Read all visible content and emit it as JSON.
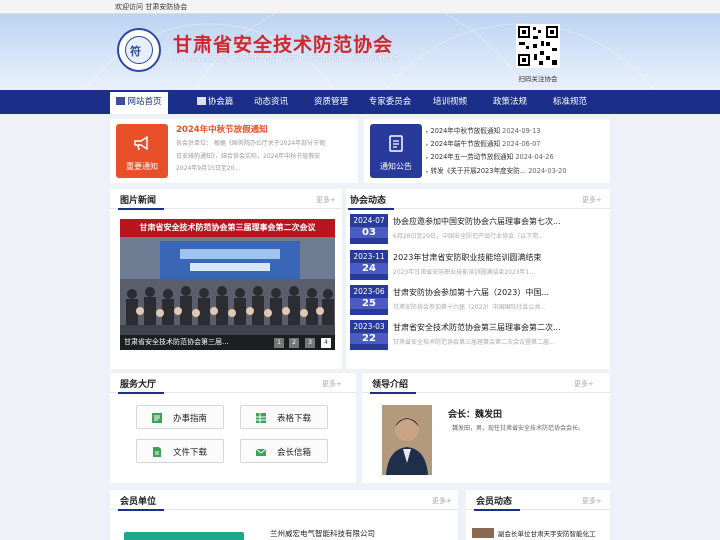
{
  "topbar": {
    "welcome": "欢迎访问 甘肃安防协会"
  },
  "header": {
    "title": "甘肃省安全技术防范协会",
    "subtitle": "Gansu safety technology and Prevention Association",
    "qr_caption": "扫码关注协会"
  },
  "nav": {
    "items": [
      {
        "label": "网站首页",
        "active": true
      },
      {
        "label": "协会篇"
      },
      {
        "label": "动态资讯"
      },
      {
        "label": "资质管理"
      },
      {
        "label": "专家委员会"
      },
      {
        "label": "培训视频"
      },
      {
        "label": "政策法规"
      },
      {
        "label": "标准规范"
      }
    ]
  },
  "notice_important": {
    "badge": "重要通知",
    "title": "2024年中秋节放假通知",
    "lines": [
      "各会员单位：  根据《国务院办公厅关于2024年部分节假",
      "日安排的通知》，结合协会实际，2024年中秋节放假安",
      "2024年9月15日至20..."
    ]
  },
  "notice_announce": {
    "badge": "通知公告",
    "items": [
      {
        "title": "2024年中秋节放假通知",
        "date": "2024-09-13"
      },
      {
        "title": "2024年端午节放假通知",
        "date": "2024-06-07"
      },
      {
        "title": "2024年五一劳动节放假通知",
        "date": "2024-04-26"
      },
      {
        "title": "转发《关于开展2023年度安防...",
        "date": "2024-03-20"
      }
    ]
  },
  "photo_news": {
    "title": "图片新闻",
    "more": "更多+",
    "banner": "甘肃省安全技术防范协会第三届理事会第二次会议",
    "caption": "甘肃省安全技术防范协会第三届...",
    "pages": [
      "1",
      "2",
      "3",
      "4"
    ]
  },
  "association_news": {
    "title": "协会动态",
    "more": "更多+",
    "items": [
      {
        "ym": "2024-07",
        "day": "03",
        "title": "协会应邀参加中国安防协会六届理事会第七次...",
        "desc": "6月28日至29日，中国安全防范产品行业协会（以下简..."
      },
      {
        "ym": "2023-11",
        "day": "24",
        "title": "2023年甘肃省安防职业技能培训圆满结束",
        "desc": "2023年甘肃省安防职业技能培训圆满结束2023年1..."
      },
      {
        "ym": "2023-06",
        "day": "25",
        "title": "甘肃安防协会参加第十六届（2023）中国...",
        "desc": "甘肃安防协会参加第十六届（2023）中国国际社会公共..."
      },
      {
        "ym": "2023-03",
        "day": "22",
        "title": "甘肃省安全技术防范协会第三届理事会第二次...",
        "desc": "甘肃省安全技术防范协会第三届理事会第二次会议暨第二届..."
      }
    ]
  },
  "service": {
    "title": "服务大厅",
    "more": "更多+",
    "buttons": [
      {
        "label": "办事指南",
        "icon": "guide-icon"
      },
      {
        "label": "表格下载",
        "icon": "table-icon"
      },
      {
        "label": "文件下载",
        "icon": "file-icon"
      },
      {
        "label": "会长信箱",
        "icon": "mail-icon"
      }
    ]
  },
  "leader": {
    "title": "领导介绍",
    "more": "更多+",
    "name": "会长：魏发田",
    "desc": "魏发田，男，现任甘肃省安全技术防范协会会长。"
  },
  "members": {
    "title": "会员单位",
    "more": "更多+",
    "first_member": "兰州威宏电气智能科技有限公司"
  },
  "member_news": {
    "title": "会员动态",
    "more": "更多+",
    "first_item": "副会长单位甘肃天宇安防智能化工"
  },
  "colors": {
    "nav": "#1a2e8a",
    "accent_red": "#d2262c",
    "important": "#e8502a",
    "announce": "#283a9a"
  }
}
